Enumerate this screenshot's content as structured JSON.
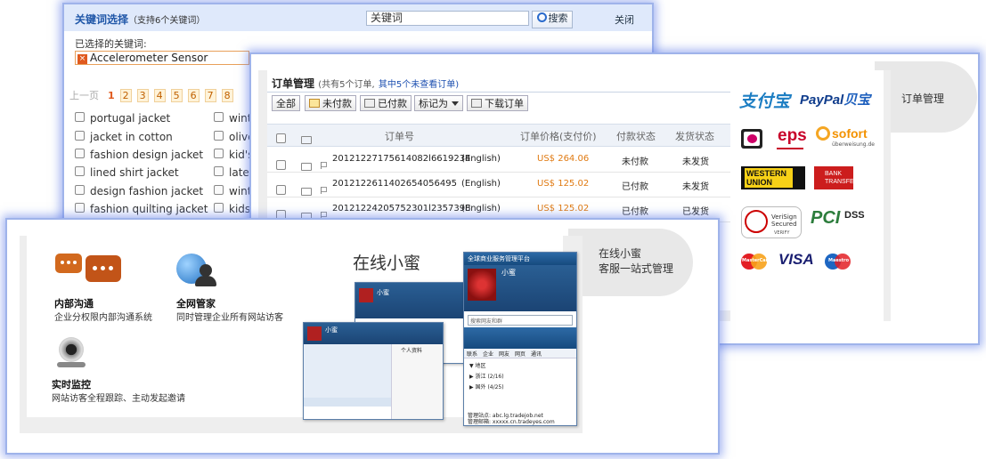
{
  "keyword_panel": {
    "title": "关键词选择",
    "subtitle": "（支持6个关键词）",
    "search_value": "关键词",
    "search_button": "搜索",
    "close_label": "关闭",
    "selected_label": "已选择的关键词:",
    "selected_chip": "Accelerometer Sensor",
    "pager": {
      "prev": "上一页",
      "pages": [
        "1",
        "2",
        "3",
        "4",
        "5",
        "6",
        "7",
        "8"
      ],
      "current": "1"
    },
    "keywords_col1": [
      "portugal jacket",
      "jacket in cotton",
      "fashion design jacket",
      "lined shirt jacket",
      "design fashion jacket",
      "fashion quilting jacket"
    ],
    "keywords_col2": [
      "winte",
      "olive",
      "kid's",
      "lates",
      "winte",
      "kids"
    ]
  },
  "orders_panel": {
    "title": "订单管理",
    "subtitle": "(共有5个订单,",
    "unviewed": "其中5个未查看订单)",
    "toolbar": {
      "all": "全部",
      "unpaid": "未付款",
      "paid": "已付款",
      "mark_as": "标记为",
      "download": "下载订单"
    },
    "columns": {
      "order_no": "订单号",
      "price": "订单价格(支付价)",
      "pay_status": "付款状态",
      "ship_status": "发货状态"
    },
    "rows": [
      {
        "id": "20121227175614082l6619234",
        "lang": "(English)",
        "price": "US$ 264.06",
        "pay": "未付款",
        "ship": "未发货"
      },
      {
        "id": "2012122611402654056495",
        "lang": "(English)",
        "price": "US$ 125.02",
        "pay": "已付款",
        "ship": "未发货"
      },
      {
        "id": "20121224205752301l2357398",
        "lang": "(English)",
        "price": "US$ 125.02",
        "pay": "已付款",
        "ship": "已发货"
      }
    ],
    "side_tab": "订单管理"
  },
  "payment_logos": {
    "alipay": "支付宝",
    "paypal": "PayPal",
    "paypal_cn": "贝宝",
    "eps": "eps",
    "sofort": "sofort",
    "sofort_sub": "überweisung.de",
    "western_union_1": "WESTERN",
    "western_union_2": "UNION",
    "bank_transfer_1": "BANK",
    "bank_transfer_2": "TRANSFER",
    "verisign_1": "VeriSign",
    "verisign_2": "Secured",
    "verisign_3": "VERIFY",
    "pci": "PCI",
    "dss": "DSS",
    "visa": "VISA",
    "mastercard": "MasterCard",
    "maestro": "Maestro"
  },
  "chat_panel": {
    "features": [
      {
        "title": "内部沟通",
        "desc": "企业分权限内部沟通系统"
      },
      {
        "title": "全网管家",
        "desc": "同时管理企业所有网站访客"
      },
      {
        "title": "实时监控",
        "desc": "网站访客全程跟踪、主动发起邀请"
      }
    ],
    "product_title": "在线小蜜",
    "side_tab_1": "在线小蜜",
    "side_tab_2": "客服一站式管理",
    "mock_window": {
      "app_title": "全球商业服务管理平台",
      "user_name": "小蜜",
      "search_placeholder": "搜索网友和群",
      "tabs": [
        "联系",
        "企业",
        "网友",
        "网页",
        "通讯"
      ],
      "region": "地区",
      "group_1": "浙江 (2/16)",
      "group_2": "国外 (4/25)",
      "footer_1": "管理站点: abc.lg.tradejob.net",
      "footer_2": "管理邮箱: xxxxx.cn.tradeyes.com",
      "profile": "个人资料"
    }
  }
}
